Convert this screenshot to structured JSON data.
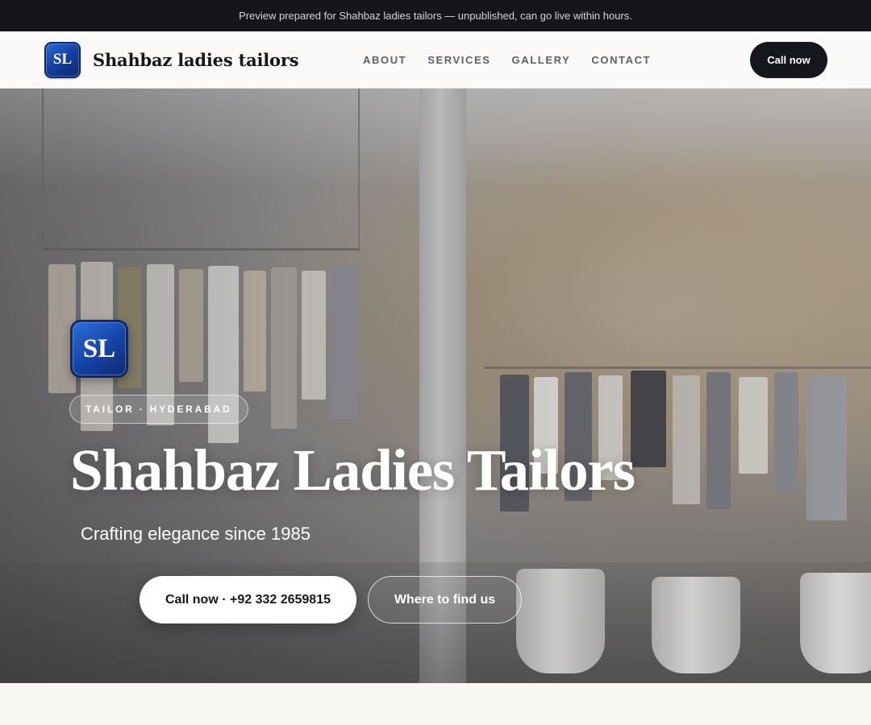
{
  "banner": {
    "text": "Preview prepared for Shahbaz ladies tailors — unpublished, can go live within hours."
  },
  "header": {
    "logo_text": "SL",
    "brand_name": "Shahbaz ladies tailors",
    "nav": [
      {
        "label": "ABOUT"
      },
      {
        "label": "SERVICES"
      },
      {
        "label": "GALLERY"
      },
      {
        "label": "CONTACT"
      }
    ],
    "cta_label": "Call now"
  },
  "hero": {
    "logo_text": "SL",
    "badge": "TAILOR · HYDERABAD",
    "title": "Shahbaz Ladies Tailors",
    "subtitle": "Crafting elegance since 1985",
    "primary_button": "Call now · +92 332 2659815",
    "secondary_button": "Where to find us"
  },
  "colors": {
    "dark": "#14161b",
    "logo_blue": "#1646ab",
    "page_bg": "#f8f7f4"
  }
}
